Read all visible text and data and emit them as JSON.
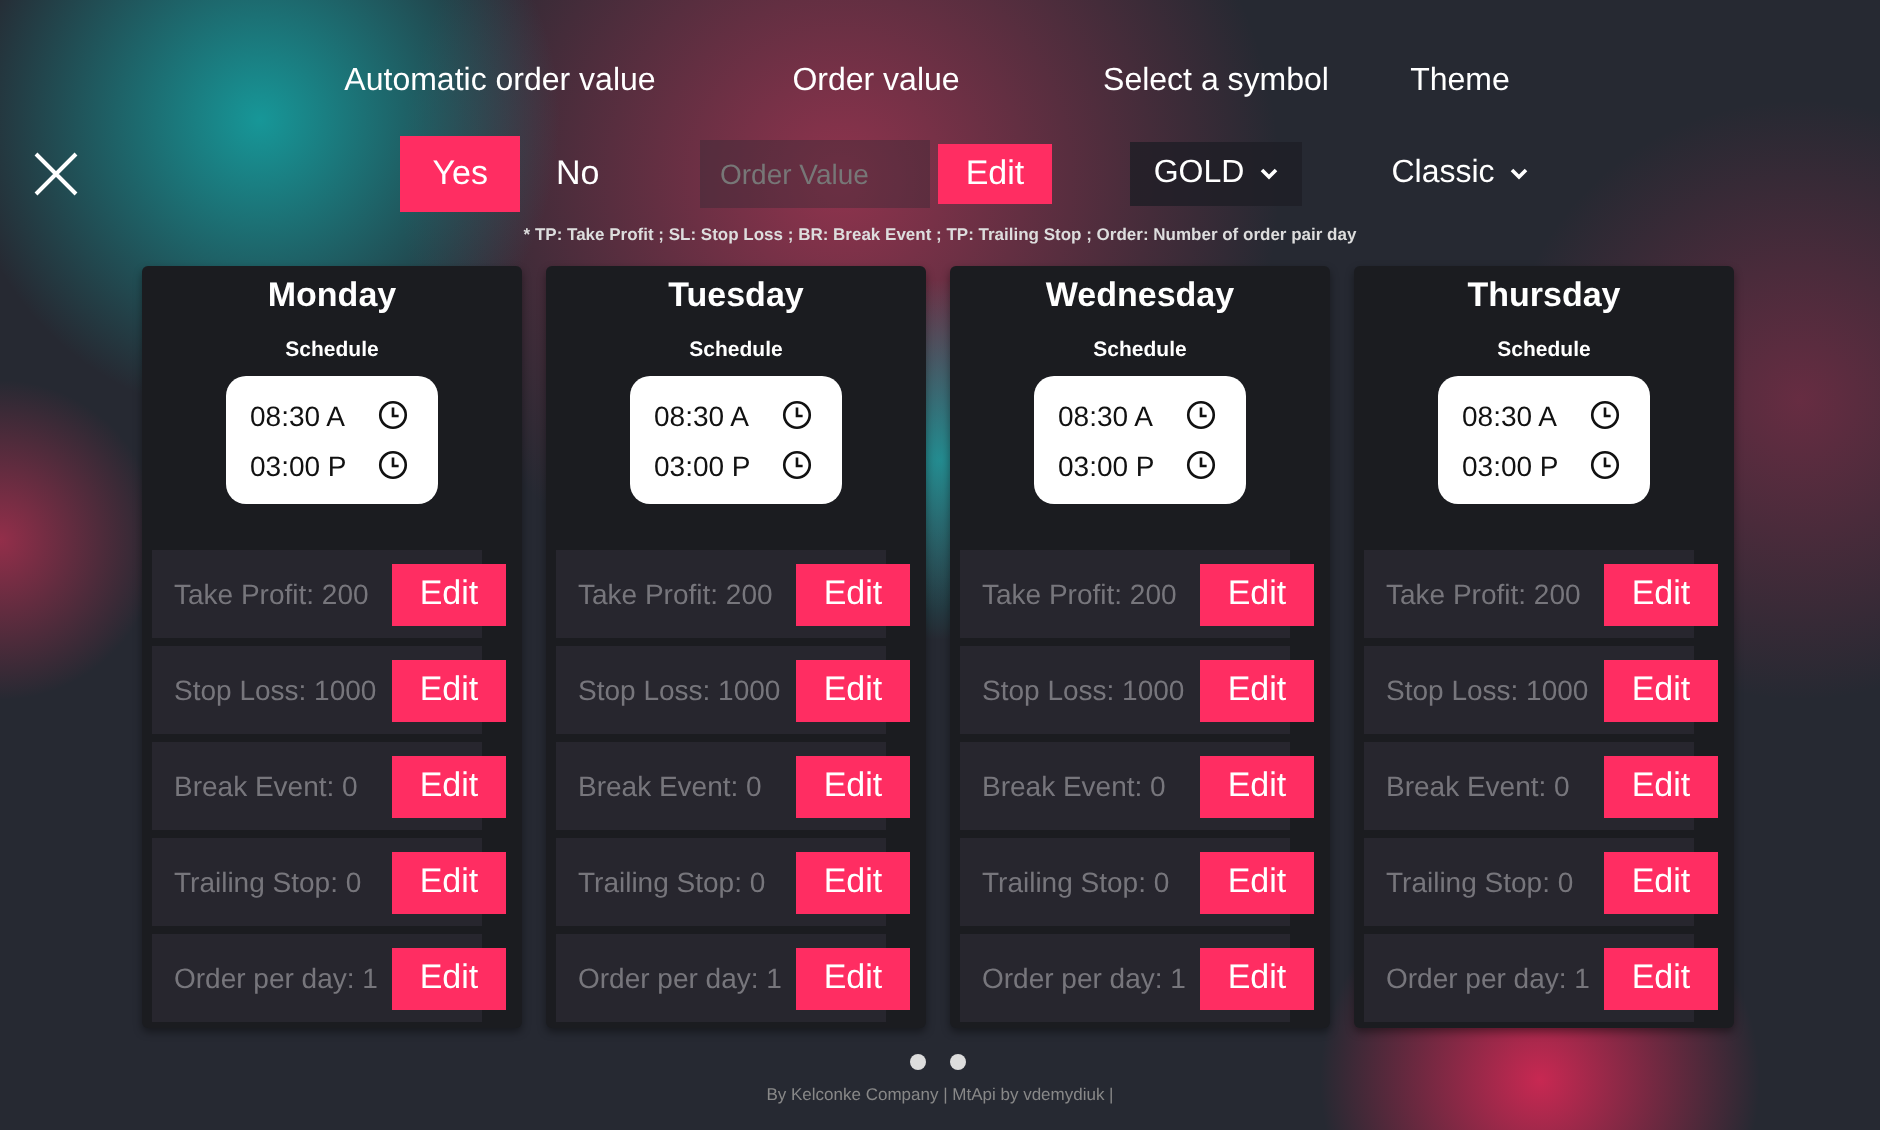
{
  "header": {
    "automatic_order_value": {
      "label": "Automatic order value",
      "options": [
        {
          "label": "Yes",
          "selected": true
        },
        {
          "label": "No",
          "selected": false
        }
      ]
    },
    "order_value": {
      "label": "Order value",
      "placeholder": "Order Value",
      "button": "Edit"
    },
    "symbol": {
      "label": "Select a symbol",
      "value": "GOLD"
    },
    "theme": {
      "label": "Theme",
      "value": "Classic"
    }
  },
  "legend": "* TP: Take Profit ; SL: Stop Loss ; BR: Break Event ; TP: Trailing Stop ; Order: Number of order pair day",
  "days": [
    {
      "name": "Monday",
      "schedule_label": "Schedule",
      "times": [
        "08:30 A",
        "03:00 P"
      ],
      "params": [
        {
          "label": "Take Profit: 200",
          "button": "Edit"
        },
        {
          "label": "Stop Loss: 1000",
          "button": "Edit"
        },
        {
          "label": "Break Event: 0",
          "button": "Edit"
        },
        {
          "label": "Trailing Stop: 0",
          "button": "Edit"
        },
        {
          "label": "Order per day: 1",
          "button": "Edit"
        }
      ]
    },
    {
      "name": "Tuesday",
      "schedule_label": "Schedule",
      "times": [
        "08:30 A",
        "03:00 P"
      ],
      "params": [
        {
          "label": "Take Profit: 200",
          "button": "Edit"
        },
        {
          "label": "Stop Loss: 1000",
          "button": "Edit"
        },
        {
          "label": "Break Event: 0",
          "button": "Edit"
        },
        {
          "label": "Trailing Stop: 0",
          "button": "Edit"
        },
        {
          "label": "Order per day: 1",
          "button": "Edit"
        }
      ]
    },
    {
      "name": "Wednesday",
      "schedule_label": "Schedule",
      "times": [
        "08:30 A",
        "03:00 P"
      ],
      "params": [
        {
          "label": "Take Profit: 200",
          "button": "Edit"
        },
        {
          "label": "Stop Loss: 1000",
          "button": "Edit"
        },
        {
          "label": "Break Event: 0",
          "button": "Edit"
        },
        {
          "label": "Trailing Stop: 0",
          "button": "Edit"
        },
        {
          "label": "Order per day: 1",
          "button": "Edit"
        }
      ]
    },
    {
      "name": "Thursday",
      "schedule_label": "Schedule",
      "times": [
        "08:30 A",
        "03:00 P"
      ],
      "params": [
        {
          "label": "Take Profit: 200",
          "button": "Edit"
        },
        {
          "label": "Stop Loss: 1000",
          "button": "Edit"
        },
        {
          "label": "Break Event: 0",
          "button": "Edit"
        },
        {
          "label": "Trailing Stop: 0",
          "button": "Edit"
        },
        {
          "label": "Order per day: 1",
          "button": "Edit"
        }
      ]
    }
  ],
  "footer": "By Kelconke Company | MtApi by vdemydiuk |"
}
